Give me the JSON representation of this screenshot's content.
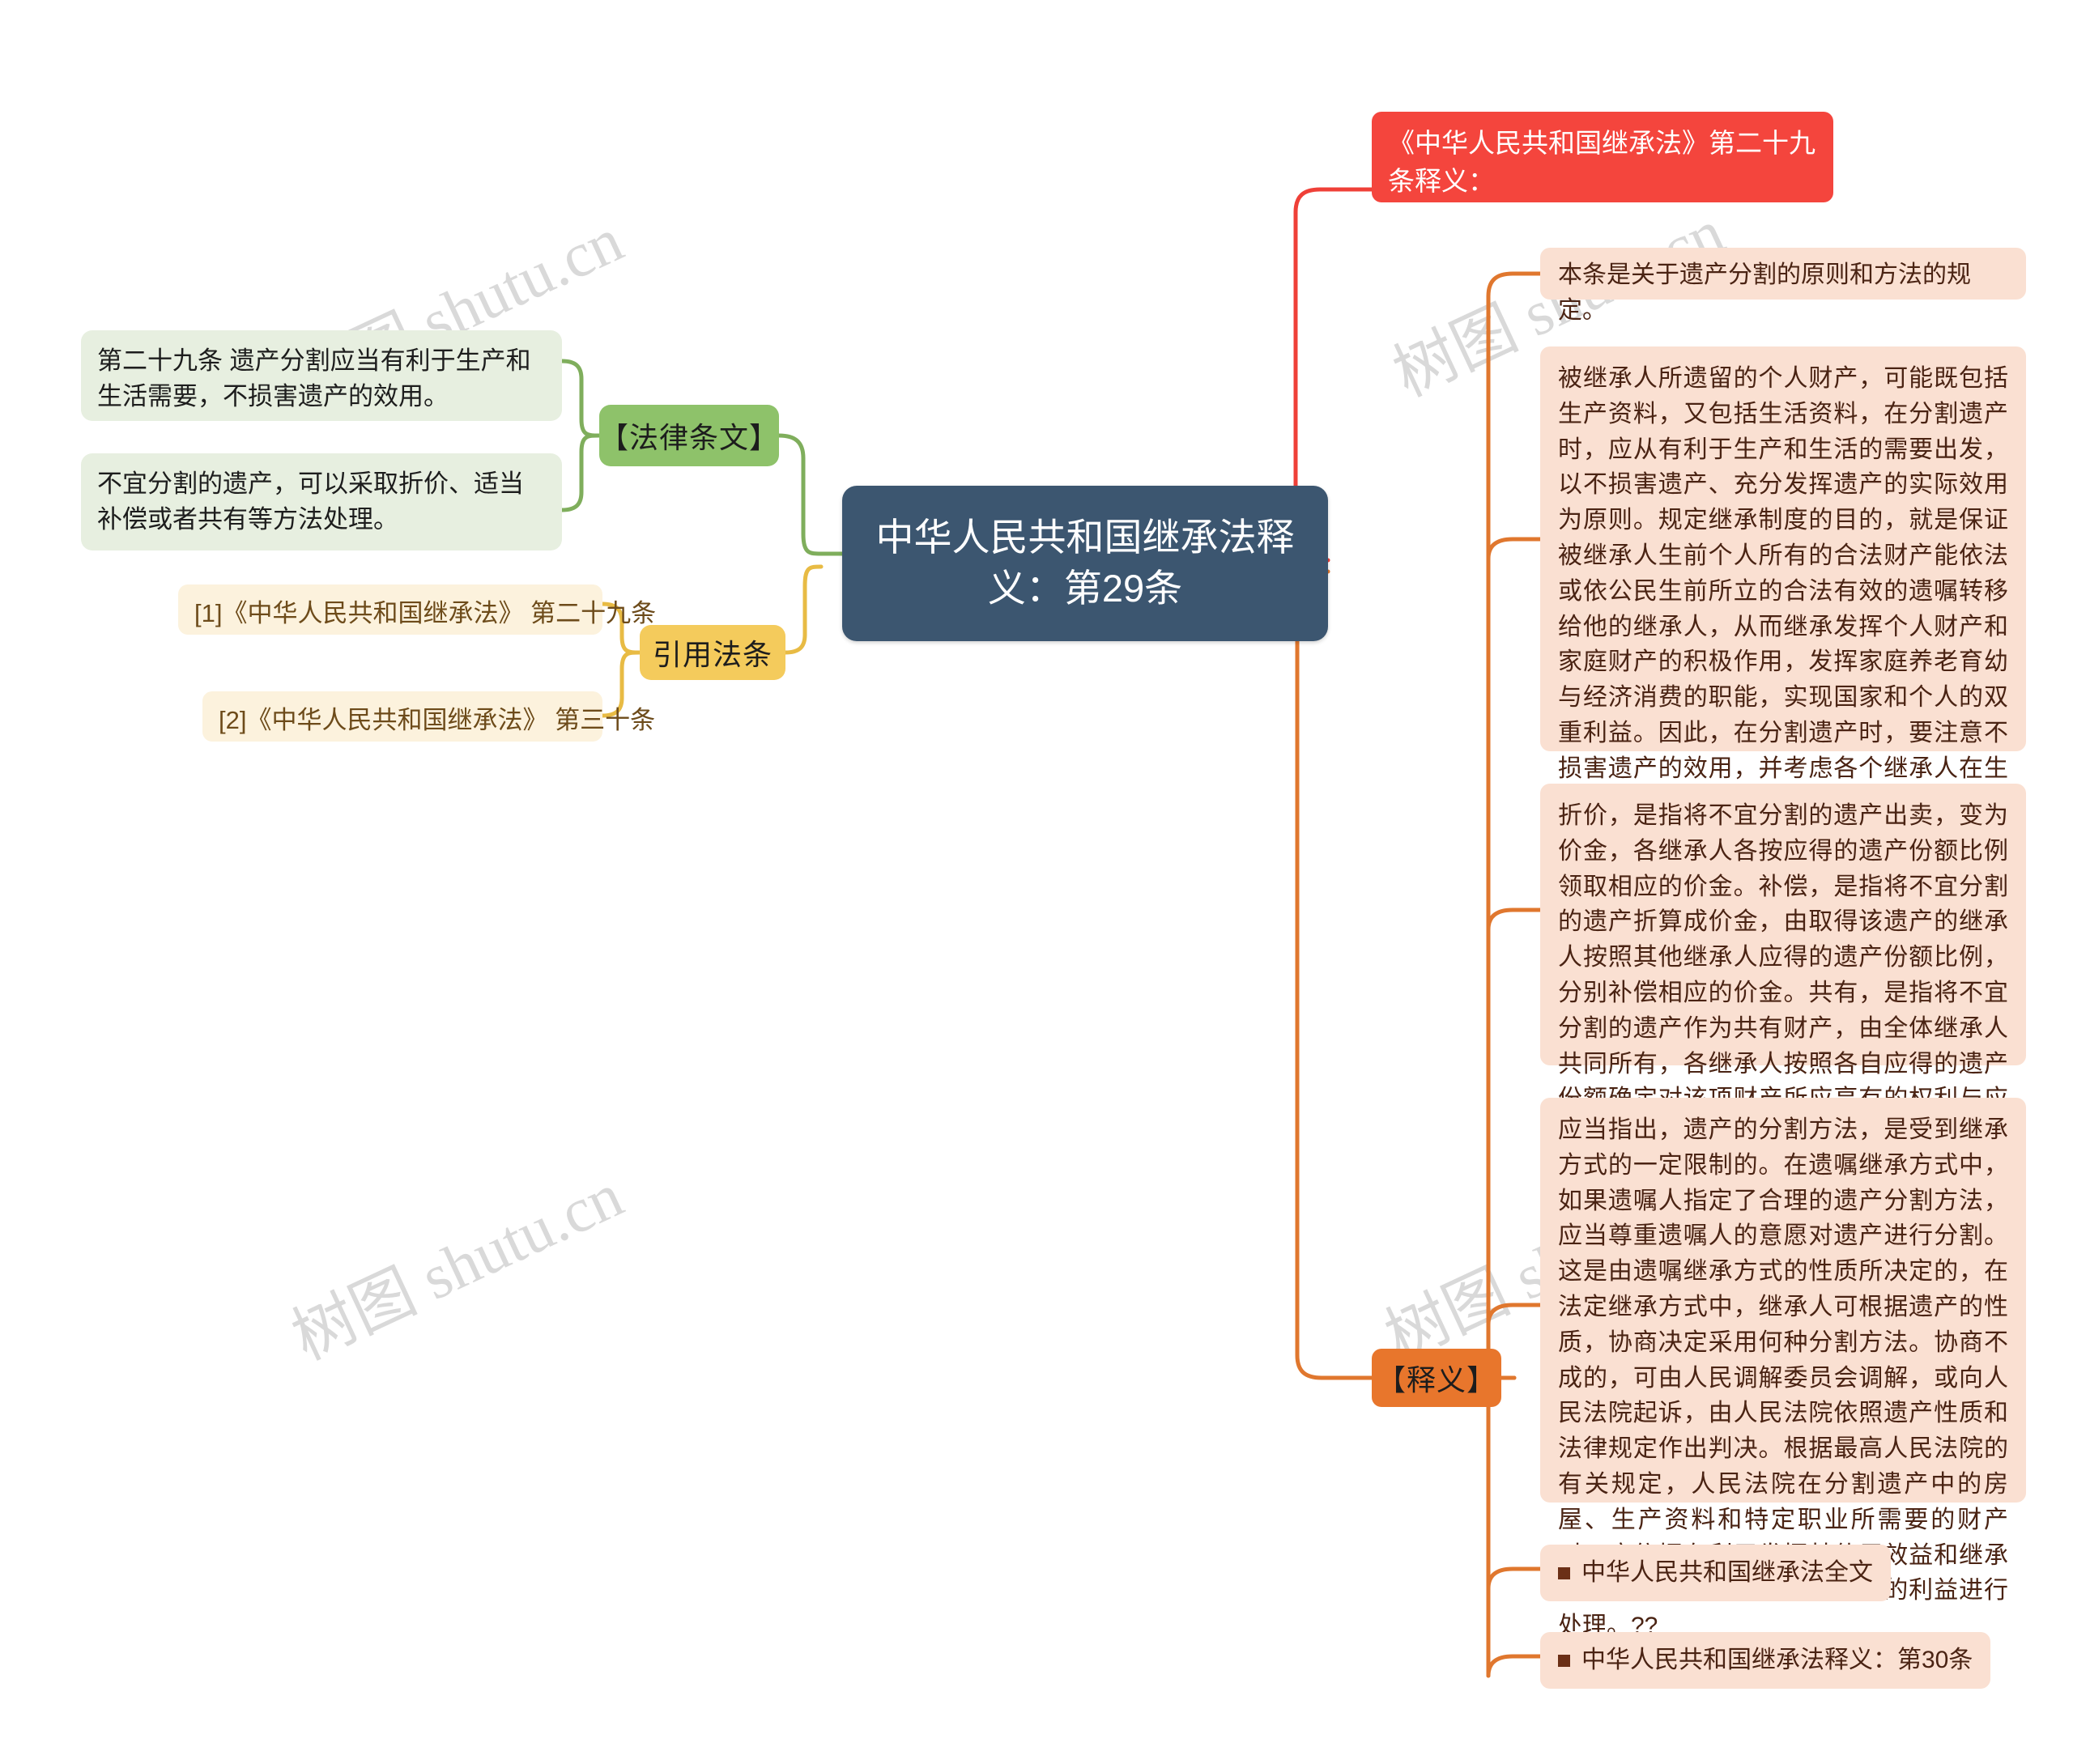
{
  "watermark": {
    "text": "树图 shutu.cn",
    "color": "#d9d9d9"
  },
  "colors": {
    "root_bg": "#3c5670",
    "green_label_bg": "#8ec26a",
    "green_leaf_bg": "#e7efe0",
    "yellow_label_bg": "#f4cb5c",
    "cream_leaf_bg": "#fcf2dd",
    "orange_label_bg": "#e8762c",
    "peach_leaf_bg": "#fae0d2",
    "red_node_bg": "#f4453d",
    "green_wire": "#7fae5c",
    "yellow_wire": "#e8bb44",
    "orange_wire": "#e0772e",
    "red_wire": "#ef4038"
  },
  "root": {
    "title": "中华人民共和国继承法释义：第29条"
  },
  "branches": {
    "legal_text": {
      "label": "【法律条文】",
      "leaves": [
        {
          "text": "第二十九条 遗产分割应当有利于生产和生活需要，不损害遗产的效用。"
        },
        {
          "text": "不宜分割的遗产，可以采取折价、适当补偿或者共有等方法处理。"
        }
      ]
    },
    "cited_articles": {
      "label": "引用法条",
      "leaves": [
        {
          "text": "[1]《中华人民共和国继承法》 第二十九条"
        },
        {
          "text": "[2]《中华人民共和国继承法》 第三十条"
        }
      ]
    },
    "red_note": {
      "text": "《中华人民共和国继承法》第二十九条释义："
    },
    "interpretation": {
      "label": "【释义】",
      "leaves": [
        {
          "type": "paragraph",
          "text": "本条是关于遗产分割的原则和方法的规定。"
        },
        {
          "type": "paragraph",
          "text": "被继承人所遗留的个人财产，可能既包括生产资料，又包括生活资料，在分割遗产时，应从有利于生产和生活的需要出发，以不损害遗产、充分发挥遗产的实际效用为原则。规定继承制度的目的，就是保证被继承人生前个人所有的合法财产能依法或依公民生前所立的合法有效的遗嘱转移给他的继承人，从而继承发挥个人财产和家庭财产的积极作用，发挥家庭养老育幼与经济消费的职能，实现国家和个人的双重利益。因此，在分割遗产时，要注意不损害遗产的效用，并考虑各个继承人在生产和生活上的实际需要，对不宜分割的遗产，应采用折价、补偿和共有等方法处理。"
        },
        {
          "type": "paragraph",
          "text": "折价，是指将不宜分割的遗产出卖，变为价金，各继承人各按应得的遗产份额比例领取相应的价金。补偿，是指将不宜分割的遗产折算成价金，由取得该遗产的继承人按照其他继承人应得的遗产份额比例，分别补偿相应的价金。共有，是指将不宜分割的遗产作为共有财产，由全体继承人共同所有，各继承人按照各自应得的遗产份额确定对该项财产所应享有的权利与应分担的义务。"
        },
        {
          "type": "paragraph",
          "text": "应当指出，遗产的分割方法，是受到继承方式的一定限制的。在遗嘱继承方式中，如果遗嘱人指定了合理的遗产分割方法，应当尊重遗嘱人的意愿对遗产进行分割。这是由遗嘱继承方式的性质所决定的，在法定继承方式中，继承人可根据遗产的性质，协商决定采用何种分割方法。协商不成的，可由人民调解委员会调解，或向人民法院起诉，由人民法院依照遗产性质和法律规定作出判决。根据最高人民法院的有关规定，人民法院在分割遗产中的房屋、生产资料和特定职业所需要的财产时，应依据有利于发挥其使用效益和继承人的实际需要，兼顾各继承人的利益进行处理。??"
        },
        {
          "type": "link",
          "text": "中华人民共和国继承法全文"
        },
        {
          "type": "link",
          "text": "中华人民共和国继承法释义：第30条"
        }
      ]
    }
  }
}
